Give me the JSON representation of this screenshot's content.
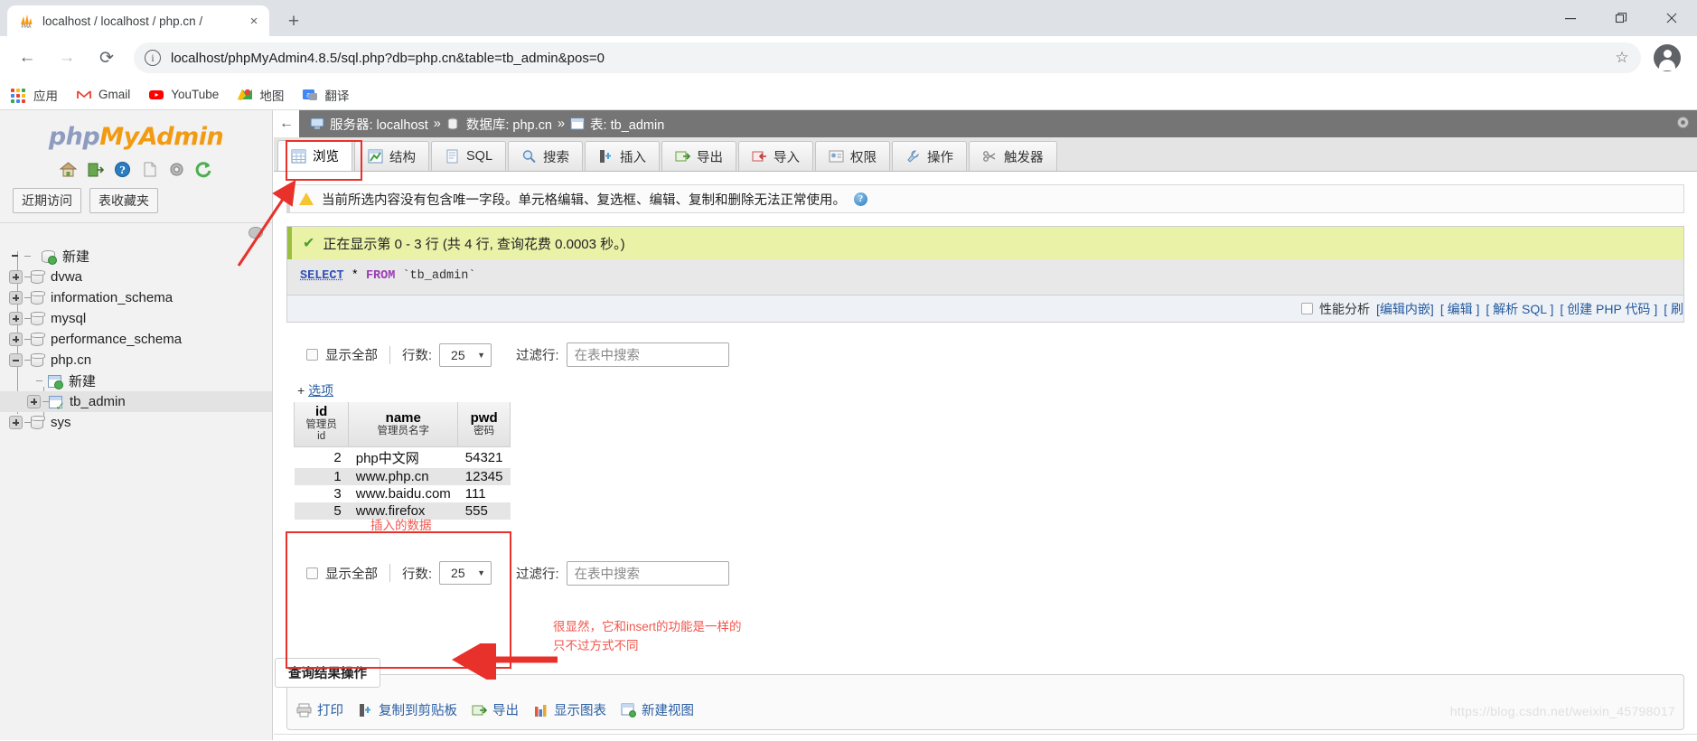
{
  "browser": {
    "tab": {
      "title": "localhost / localhost / php.cn /",
      "favicon": "phpmyadmin-favicon",
      "close_label": "×"
    },
    "new_tab_label": "+",
    "window_controls": {
      "minimize": "—",
      "maximize": "restore-icon",
      "close": "×"
    },
    "nav": {
      "back": "←",
      "forward": "→",
      "reload": "⟳"
    },
    "omnibox": {
      "info_icon": "ⓘ",
      "url": "localhost/phpMyAdmin4.8.5/sql.php?db=php.cn&table=tb_admin&pos=0",
      "star_icon": "☆"
    },
    "profile_icon": "account-avatar",
    "bookmarks": [
      {
        "label": "应用",
        "icon": "apps-grid-icon"
      },
      {
        "label": "Gmail",
        "icon": "gmail-icon"
      },
      {
        "label": "YouTube",
        "icon": "youtube-icon"
      },
      {
        "label": "地图",
        "icon": "maps-icon"
      },
      {
        "label": "翻译",
        "icon": "translate-icon"
      }
    ]
  },
  "sidebar": {
    "logo": {
      "part1": "php",
      "part2": "MyAdmin"
    },
    "quick_icons": [
      "home-icon",
      "logout-icon",
      "help-icon",
      "docs-icon",
      "settings-icon",
      "reload-icon"
    ],
    "buttons": [
      {
        "label": "近期访问"
      },
      {
        "label": "表收藏夹"
      }
    ],
    "pin_icon": "collapse-pin-icon",
    "tree": [
      {
        "label": "新建",
        "level": 1,
        "expander": "none",
        "icon": "new-database-icon",
        "selected": false
      },
      {
        "label": "dvwa",
        "level": 0,
        "expander": "plus",
        "icon": "database-icon",
        "selected": false
      },
      {
        "label": "information_schema",
        "level": 0,
        "expander": "plus",
        "icon": "database-icon",
        "selected": false
      },
      {
        "label": "mysql",
        "level": 0,
        "expander": "plus",
        "icon": "database-icon",
        "selected": false
      },
      {
        "label": "performance_schema",
        "level": 0,
        "expander": "plus",
        "icon": "database-icon",
        "selected": false
      },
      {
        "label": "php.cn",
        "level": 0,
        "expander": "minus",
        "icon": "database-icon",
        "selected": false
      },
      {
        "label": "新建",
        "level": 2,
        "expander": "none",
        "icon": "new-table-icon",
        "selected": false
      },
      {
        "label": "tb_admin",
        "level": 1,
        "expander": "plus",
        "icon": "table-icon",
        "selected": true
      },
      {
        "label": "sys",
        "level": 0,
        "expander": "plus",
        "icon": "database-icon",
        "selected": false
      }
    ]
  },
  "main": {
    "breadcrumb": {
      "back_arrow": "←",
      "items": [
        {
          "icon": "server-icon",
          "label": "服务器: localhost"
        },
        {
          "icon": "database-icon",
          "label": "数据库: php.cn"
        },
        {
          "icon": "table-icon",
          "label": "表: tb_admin"
        }
      ],
      "separator": "»",
      "gear_icon": "settings-gear-icon"
    },
    "tabs": [
      {
        "label": "浏览",
        "icon": "browse-icon",
        "active": true
      },
      {
        "label": "结构",
        "icon": "structure-icon",
        "active": false
      },
      {
        "label": "SQL",
        "icon": "sql-icon",
        "active": false
      },
      {
        "label": "搜索",
        "icon": "search-icon",
        "active": false
      },
      {
        "label": "插入",
        "icon": "insert-icon",
        "active": false
      },
      {
        "label": "导出",
        "icon": "export-icon",
        "active": false
      },
      {
        "label": "导入",
        "icon": "import-icon",
        "active": false
      },
      {
        "label": "权限",
        "icon": "privileges-icon",
        "active": false
      },
      {
        "label": "操作",
        "icon": "operations-icon",
        "active": false
      },
      {
        "label": "触发器",
        "icon": "triggers-icon",
        "active": false
      }
    ],
    "warning": {
      "icon": "warning-triangle-icon",
      "text": "当前所选内容没有包含唯一字段。单元格编辑、复选框、编辑、复制和删除无法正常使用。",
      "help_icon": "?"
    },
    "result": {
      "status_icon": "✔",
      "status_text": "正在显示第 0 - 3 行 (共 4 行, 查询花费 0.0003 秒。)",
      "sql": {
        "select": "SELECT",
        "star": "*",
        "from": "FROM",
        "table": "`tb_admin`"
      },
      "perf": {
        "checkbox_label": "性能分析",
        "links": [
          "[编辑内嵌]",
          "[ 编辑 ]",
          "[ 解析 SQL ]",
          "[ 创建 PHP 代码 ]",
          "[ 刷"
        ]
      }
    },
    "controls_top": {
      "show_all_label": "显示全部",
      "rows_label": "行数:",
      "rows_value": "25",
      "filter_label": "过滤行:",
      "filter_placeholder": "在表中搜索"
    },
    "controls_bottom": {
      "show_all_label": "显示全部",
      "rows_label": "行数:",
      "rows_value": "25",
      "filter_label": "过滤行:",
      "filter_placeholder": "在表中搜索"
    },
    "data_table": {
      "options_plus": "+",
      "options_label": "选项",
      "columns": [
        {
          "name": "id",
          "comment": "管理员id"
        },
        {
          "name": "name",
          "comment": "管理员名字"
        },
        {
          "name": "pwd",
          "comment": "密码"
        }
      ],
      "rows": [
        {
          "id": "2",
          "name": "php中文网",
          "pwd": "54321"
        },
        {
          "id": "1",
          "name": "www.php.cn",
          "pwd": "12345"
        },
        {
          "id": "3",
          "name": "www.baidu.com",
          "pwd": "111"
        },
        {
          "id": "5",
          "name": "www.firefox",
          "pwd": "555"
        }
      ]
    },
    "ops": {
      "legend": "查询结果操作",
      "links": [
        {
          "label": "打印",
          "icon": "print-icon"
        },
        {
          "label": "复制到剪贴板",
          "icon": "clipboard-icon"
        },
        {
          "label": "导出",
          "icon": "export-icon"
        },
        {
          "label": "显示图表",
          "icon": "chart-icon"
        },
        {
          "label": "新建视图",
          "icon": "new-view-icon"
        }
      ]
    }
  },
  "annotations": {
    "inserted_data_label": "插入的数据",
    "note_line1": "很显然，它和insert的功能是一样的",
    "note_line2": "只不过方式不同",
    "highlight_color": "#e8312a"
  },
  "watermark": "https://blog.csdn.net/weixin_45798017"
}
